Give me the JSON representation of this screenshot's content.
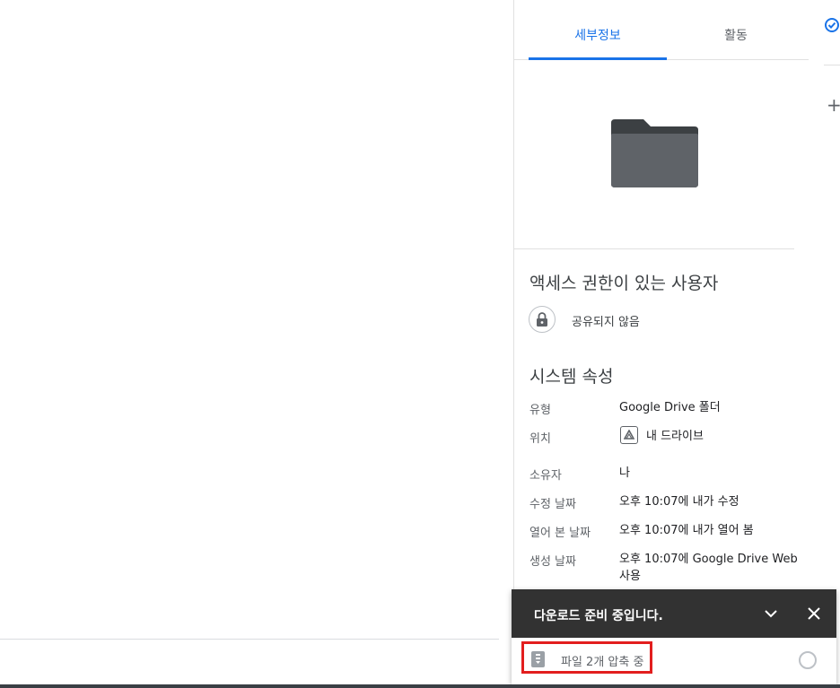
{
  "tabs": {
    "details": "세부정보",
    "activity": "활동"
  },
  "access": {
    "title": "액세스 권한이 있는 사용자",
    "status": "공유되지 않음"
  },
  "system": {
    "title": "시스템 속성",
    "type_label": "유형",
    "type_value": "Google Drive 폴더",
    "location_label": "위치",
    "location_value": "내 드라이브",
    "owner_label": "소유자",
    "owner_value": "나",
    "modified_label": "수정 날짜",
    "modified_value": "오후 10:07에 내가 수정",
    "opened_label": "열어 본 날짜",
    "opened_value": "오후 10:07에 내가 열어 봄",
    "created_label": "생성 날짜",
    "created_value": "오후 10:07에 Google Drive Web 사용"
  },
  "download": {
    "title": "다운로드 준비 중입니다.",
    "file_status": "파일 2개 압축 중"
  },
  "colors": {
    "accent": "#1a73e8",
    "folder": "#5f6368",
    "header_dark": "#323232",
    "highlight": "#e21e1e"
  },
  "icons": [
    "folder-icon",
    "lock-icon",
    "drive-icon",
    "check-icon",
    "plus-icon",
    "chevron-down-icon",
    "close-icon",
    "zip-icon"
  ]
}
